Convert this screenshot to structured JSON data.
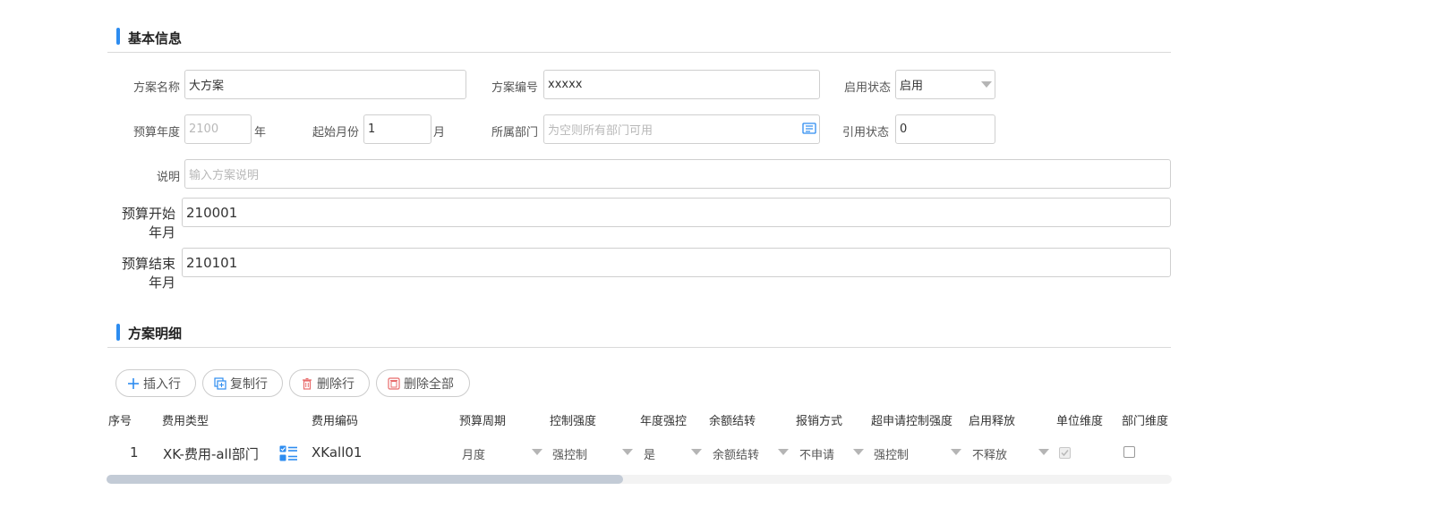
{
  "basic": {
    "title": "基本信息",
    "plan_name_label": "方案名称",
    "plan_name_value": "大方案",
    "plan_code_label": "方案编号",
    "plan_code_value": "xxxxx",
    "status_label": "启用状态",
    "status_value": "启用",
    "year_label": "预算年度",
    "year_value": "2100",
    "year_unit": "年",
    "start_month_label": "起始月份",
    "start_month_value": "1",
    "month_unit": "月",
    "dept_label": "所属部门",
    "dept_placeholder": "为空则所有部门可用",
    "ref_status_label": "引用状态",
    "ref_status_value": "0",
    "desc_label": "说明",
    "desc_placeholder": "输入方案说明",
    "start_ym_label_1": "预算开始",
    "start_ym_label_2": "年月",
    "start_ym_value": "210001",
    "end_ym_label_1": "预算结束",
    "end_ym_label_2": "年月",
    "end_ym_value": "210101"
  },
  "detail": {
    "title": "方案明细",
    "buttons": {
      "insert": "插入行",
      "copy": "复制行",
      "delete": "删除行",
      "delete_all": "删除全部"
    },
    "columns": [
      "序号",
      "费用类型",
      "费用编码",
      "预算周期",
      "控制强度",
      "年度强控",
      "余额结转",
      "报销方式",
      "超申请控制强度",
      "启用释放",
      "单位维度",
      "部门维度"
    ],
    "rows": [
      {
        "index": "1",
        "fee_type": "XK-费用-all部门",
        "fee_code": "XKall01",
        "period": "月度",
        "control": "强控制",
        "annual_control": "是",
        "balance_carry": "余额结转",
        "reimburse": "不申请",
        "over_control": "强控制",
        "release": "不释放",
        "unit_dim_checked": true,
        "dept_dim_checked": false
      }
    ]
  },
  "colors": {
    "accent": "#2d8cf0",
    "border": "#cfcfcf",
    "scrollbar": "#c3cbd6"
  }
}
